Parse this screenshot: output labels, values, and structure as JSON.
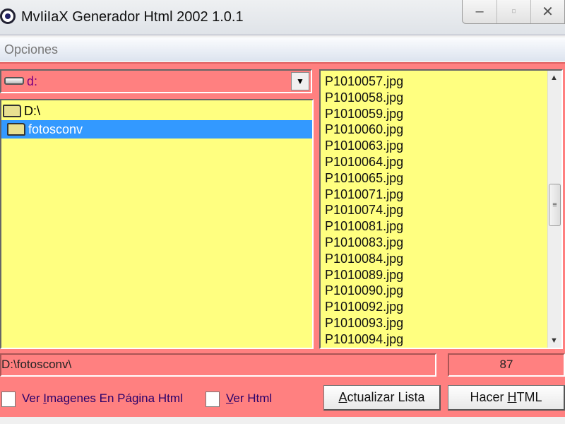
{
  "window": {
    "title": "MvIiIaX Generador Html 2002 1.0.1",
    "minimize": "‒",
    "maximize": "▫",
    "close": "✕"
  },
  "menu": {
    "items": [
      {
        "label": "Opciones"
      }
    ]
  },
  "drive": {
    "value": "d:",
    "dropdown_arrow": "▼"
  },
  "tree": {
    "nodes": [
      {
        "label": "D:\\",
        "selected": false
      },
      {
        "label": "fotosconv",
        "selected": true
      }
    ]
  },
  "files": [
    "P1010057.jpg",
    "P1010058.jpg",
    "P1010059.jpg",
    "P1010060.jpg",
    "P1010063.jpg",
    "P1010064.jpg",
    "P1010065.jpg",
    "P1010071.jpg",
    "P1010074.jpg",
    "P1010081.jpg",
    "P1010083.jpg",
    "P1010084.jpg",
    "P1010089.jpg",
    "P1010090.jpg",
    "P1010092.jpg",
    "P1010093.jpg",
    "P1010094.jpg"
  ],
  "path": "D:\\fotosconv\\",
  "count": "87",
  "options": {
    "ver_imagenes": {
      "label_pre": "Ver ",
      "label_u": "I",
      "label_post": "magenes En Página Html",
      "checked": false
    },
    "ver_html": {
      "label_pre": "",
      "label_u": "V",
      "label_post": "er Html",
      "checked": false
    }
  },
  "buttons": {
    "actualizar": {
      "pre": "",
      "u": "A",
      "post": "ctualizar Lista"
    },
    "hacer": {
      "pre": "Hacer ",
      "u": "H",
      "post": "TML"
    }
  },
  "colors": {
    "panel": "#ff8080",
    "list_bg": "#ffff80",
    "selection": "#3399ff"
  }
}
